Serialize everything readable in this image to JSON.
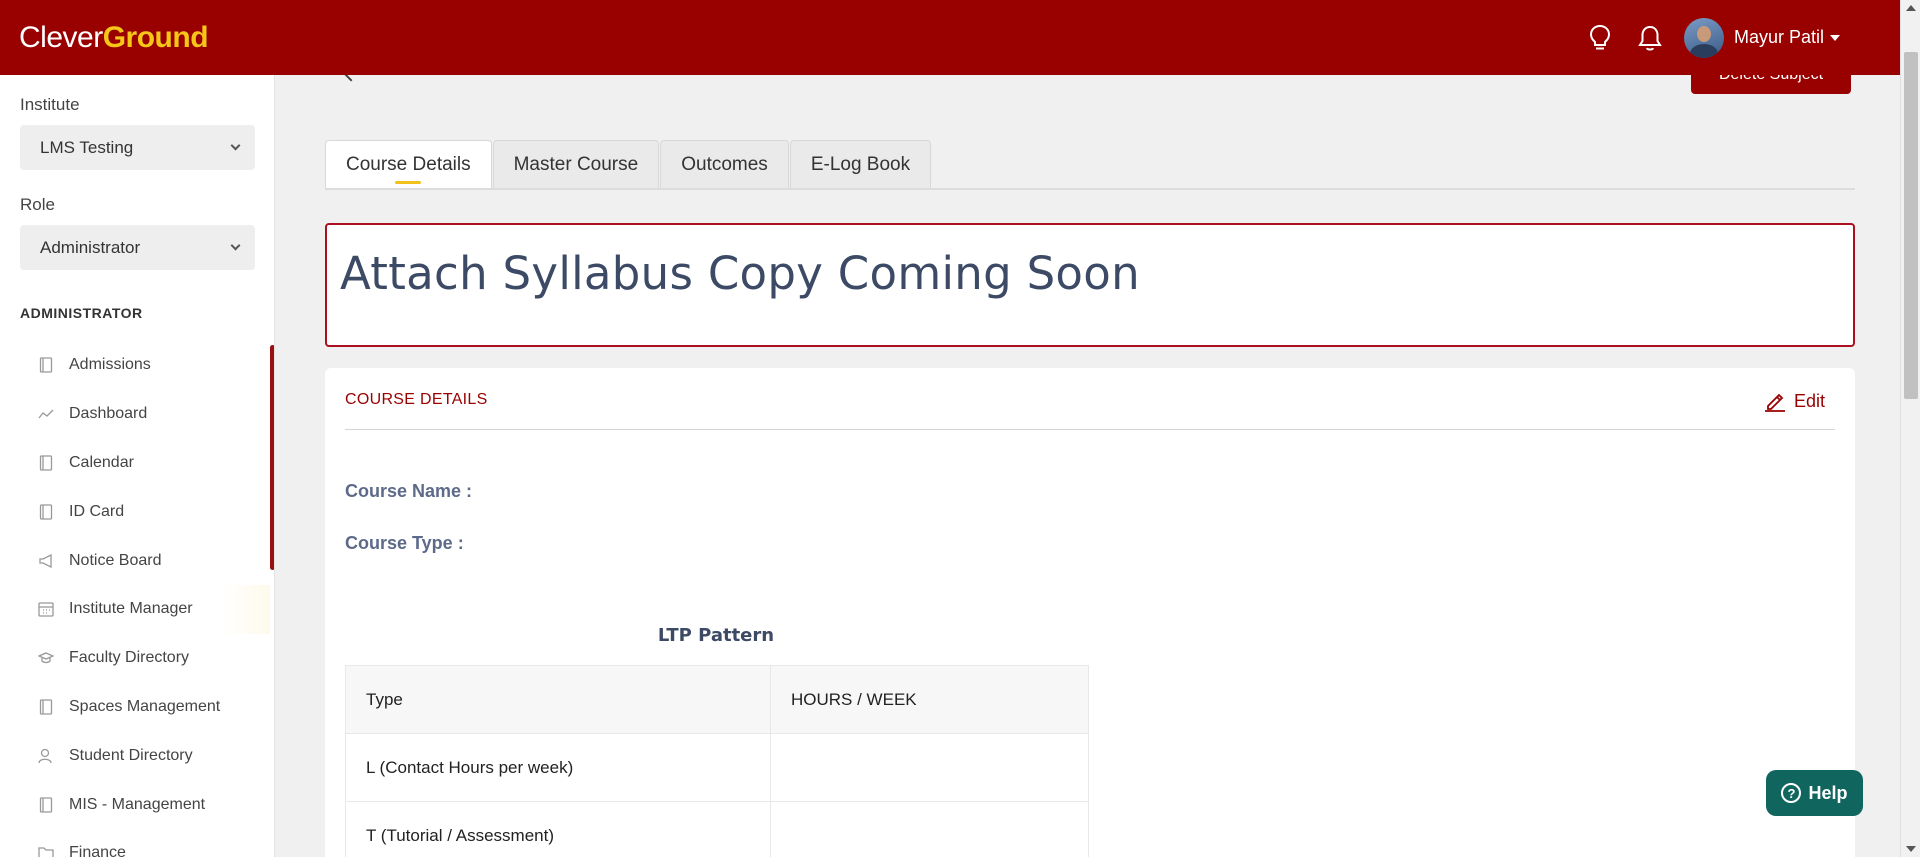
{
  "app": {
    "logo_part1": "Clever",
    "logo_part2": "Ground",
    "brand_color": "#990000",
    "accent_color": "#f5c518"
  },
  "header": {
    "icons": [
      "lightbulb-icon",
      "bell-icon"
    ],
    "user_name": "Mayur Patil"
  },
  "sidebar": {
    "institute_label": "Institute",
    "institute_value": "LMS Testing",
    "role_label": "Role",
    "role_value": "Administrator",
    "section_title": "ADMINISTRATOR",
    "items": [
      {
        "label": "Admissions",
        "icon": "book-icon"
      },
      {
        "label": "Dashboard",
        "icon": "trend-line-icon"
      },
      {
        "label": "Calendar",
        "icon": "book-icon"
      },
      {
        "label": "ID Card",
        "icon": "book-icon"
      },
      {
        "label": "Notice Board",
        "icon": "megaphone-icon"
      },
      {
        "label": "Institute Manager",
        "icon": "calendar-grid-icon"
      },
      {
        "label": "Faculty Directory",
        "icon": "graduation-cap-icon"
      },
      {
        "label": "Spaces Management",
        "icon": "book-icon"
      },
      {
        "label": "Student Directory",
        "icon": "user-icon"
      },
      {
        "label": "MIS - Management",
        "icon": "book-icon"
      },
      {
        "label": "Finance",
        "icon": "folder-icon"
      }
    ]
  },
  "main": {
    "delete_button": "Delete Subject",
    "tabs": [
      {
        "label": "Course Details"
      },
      {
        "label": "Master Course"
      },
      {
        "label": "Outcomes"
      },
      {
        "label": "E-Log Book"
      }
    ],
    "banner": "Attach Syllabus Copy Coming Soon",
    "card": {
      "title": "COURSE DETAILS",
      "edit_label": "Edit",
      "course_name_label": "Course Name :",
      "course_type_label": "Course Type :",
      "ltp_title": "LTP Pattern",
      "table": {
        "headers": [
          "Type",
          "HOURS / WEEK"
        ],
        "rows": [
          [
            "L (Contact Hours per week)",
            ""
          ],
          [
            "T (Tutorial / Assessment)",
            ""
          ]
        ]
      }
    }
  },
  "help_button": "Help"
}
